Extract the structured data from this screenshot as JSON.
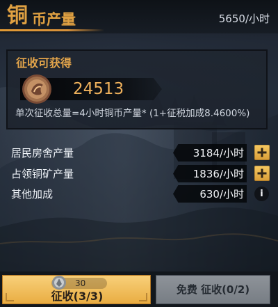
{
  "header": {
    "title_big": "铜",
    "title_small": "币产量",
    "rate": "5650/小时"
  },
  "collect": {
    "label": "征收可获得",
    "amount": "24513",
    "formula": "单次征收总量=4小时铜币产量* (1+征税加成8.4600%)"
  },
  "rows": [
    {
      "label": "居民房舍产量",
      "value": "3184/小时",
      "action": "plus-icon"
    },
    {
      "label": "占领铜矿产量",
      "value": "1836/小时",
      "action": "plus-icon"
    },
    {
      "label": "其他加成",
      "value": "630/小时",
      "action": "info-icon"
    }
  ],
  "buttons": {
    "collect": {
      "cost": "30",
      "label": "征收(3/3)"
    },
    "free": {
      "label": "免费 征收(0/2)"
    }
  },
  "icons": {
    "coin": "copper-coin-icon",
    "cost": "silver-token-icon",
    "plus": "plus-icon",
    "info": "info-icon"
  },
  "colors": {
    "accent": "#e0a142",
    "amount": "#efb15c",
    "collect_button": "#f0bf58",
    "free_button": "#858a90"
  }
}
